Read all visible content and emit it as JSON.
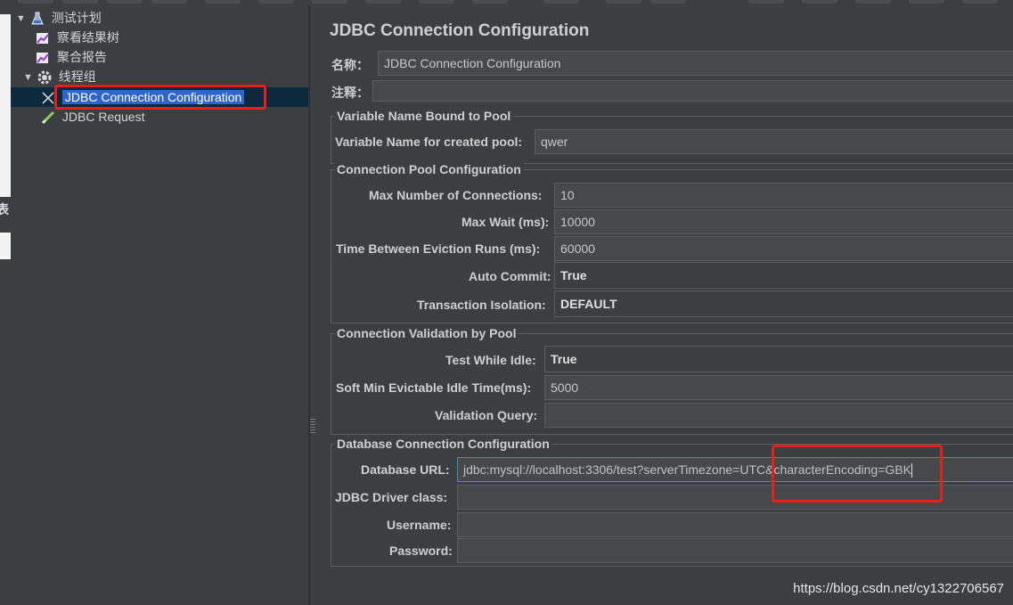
{
  "tree": {
    "items": [
      {
        "label": "测试计划",
        "icon": "test-plan-icon"
      },
      {
        "label": "察看结果树",
        "icon": "listener-chart-icon"
      },
      {
        "label": "聚合报告",
        "icon": "listener-chart-icon"
      },
      {
        "label": "线程组",
        "icon": "gear-icon"
      },
      {
        "label": "JDBC Connection Configuration",
        "icon": "config-element-icon"
      },
      {
        "label": "JDBC Request",
        "icon": "sampler-pen-icon"
      }
    ],
    "expand_arrow": "▼"
  },
  "left_strip": {
    "fragment": "表"
  },
  "panel": {
    "title": "JDBC Connection Configuration",
    "name_label": "名称：",
    "name_value": "JDBC Connection Configuration",
    "comment_label": "注释：",
    "comment_value": ""
  },
  "pool_var": {
    "group_title": "Variable Name Bound to Pool",
    "label": "Variable Name for created pool:",
    "value": "qwer"
  },
  "pool_cfg": {
    "group_title": "Connection Pool Configuration",
    "max_conn_label": "Max Number of Connections:",
    "max_conn_value": "10",
    "max_wait_label": "Max Wait (ms):",
    "max_wait_value": "10000",
    "eviction_label": "Time Between Eviction Runs (ms):",
    "eviction_value": "60000",
    "auto_commit_label": "Auto Commit:",
    "auto_commit_value": "True",
    "isolation_label": "Transaction Isolation:",
    "isolation_value": "DEFAULT"
  },
  "validation": {
    "group_title": "Connection Validation by Pool",
    "test_idle_label": "Test While Idle:",
    "test_idle_value": "True",
    "soft_min_label": "Soft Min Evictable Idle Time(ms):",
    "soft_min_value": "5000",
    "query_label": "Validation Query:",
    "query_value": ""
  },
  "db": {
    "group_title": "Database Connection Configuration",
    "url_label": "Database URL:",
    "url_value": "jdbc:mysql://localhost:3306/test?serverTimezone=UTC&characterEncoding=GBK",
    "driver_label": "JDBC Driver class:",
    "driver_value": "",
    "username_label": "Username:",
    "username_value": "",
    "password_label": "Password:",
    "password_value": ""
  },
  "watermark": "https://blog.csdn.net/cy1322706567",
  "colors": {
    "highlight": "#e3201a",
    "selection": "#2f65ca"
  }
}
